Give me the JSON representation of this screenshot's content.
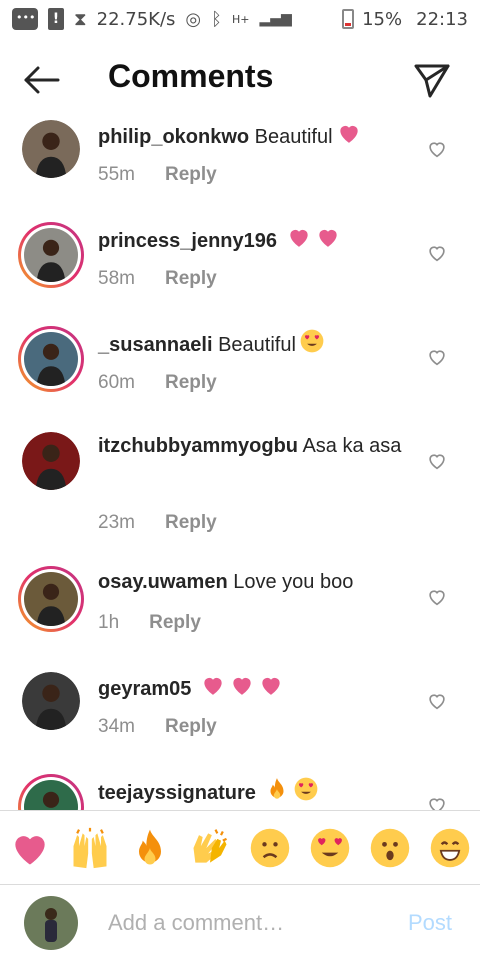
{
  "status_bar": {
    "speed": "22.75K/s",
    "network": "H+",
    "battery": "15%",
    "time": "22:13"
  },
  "header": {
    "title": "Comments",
    "back_icon": "arrow-left-icon",
    "share_icon": "paper-plane-icon"
  },
  "comments": [
    {
      "username": "philip_okonkwo",
      "text": " Beautiful",
      "emoji": [
        "heart"
      ],
      "time": "55m",
      "reply": "Reply",
      "story_ring": false,
      "avatar_color": "#7a6a5a"
    },
    {
      "username": "princess_jenny196",
      "text": " ",
      "emoji": [
        "heart",
        "heart"
      ],
      "time": "58m",
      "reply": "Reply",
      "story_ring": true,
      "avatar_color": "#8d8c86"
    },
    {
      "username": "_susannaeli",
      "text": " Beautiful",
      "emoji": [
        "heart-eyes"
      ],
      "time": "60m",
      "reply": "Reply",
      "story_ring": true,
      "avatar_color": "#4a6a7d"
    },
    {
      "username": "itzchubbyammyogbu",
      "text": " Asa ka asa",
      "emoji": [],
      "time": "23m",
      "reply": "Reply",
      "story_ring": false,
      "avatar_color": "#7a1818"
    },
    {
      "username": "osay.uwamen",
      "text": " Love you boo",
      "emoji": [],
      "time": "1h",
      "reply": "Reply",
      "story_ring": true,
      "avatar_color": "#6b5a3a"
    },
    {
      "username": "geyram05",
      "text": " ",
      "emoji": [
        "heart",
        "heart",
        "heart"
      ],
      "time": "34m",
      "reply": "Reply",
      "story_ring": false,
      "avatar_color": "#3a3a3a"
    },
    {
      "username": "teejayssignature",
      "text": " ",
      "emoji": [
        "fire",
        "heart-eyes"
      ],
      "time": "",
      "reply": "",
      "story_ring": true,
      "avatar_color": "#2e6b4a"
    }
  ],
  "emoji_bar": [
    "heart",
    "raised-hands",
    "fire",
    "clapping-hands",
    "sad-face",
    "heart-eyes",
    "surprised-face",
    "grinning-face"
  ],
  "input": {
    "placeholder": "Add a comment…",
    "post_label": "Post"
  },
  "colors": {
    "heart": "#e75b8d",
    "accent_post": "#b3dbff",
    "meta_text": "#8e8e8e"
  }
}
